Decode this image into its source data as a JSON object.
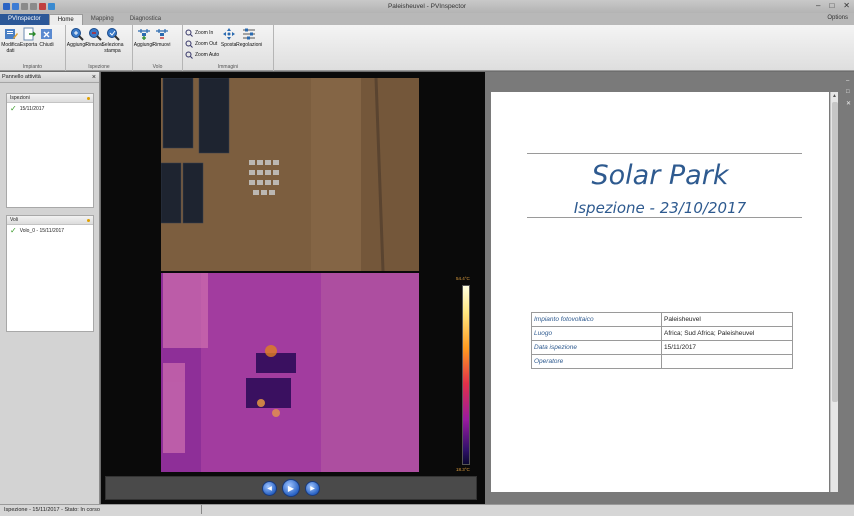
{
  "window": {
    "title": "Paleisheuvel - PVInspector"
  },
  "tabs": {
    "app": "PVInspector",
    "home": "Home",
    "mapping": "Mapping",
    "diagnostica": "Diagnostica",
    "options": "Options"
  },
  "ribbon": {
    "impianto": {
      "label": "Impianto",
      "modifica": "Modifica dati",
      "esporta": "Esporta",
      "chiudi": "Chiudi"
    },
    "ispezione": {
      "label": "Ispezione",
      "aggiungi": "Aggiungi",
      "rimuovi": "Rimuovi",
      "seleziona": "Seleziona stampa"
    },
    "voli": {
      "label": "Volo",
      "aggiungi": "Aggiungi",
      "rimuovi": "Rimuovi"
    },
    "immagini": {
      "label": "Immagini",
      "zoom_in": "Zoom In",
      "zoom_out": "Zoom Out",
      "zoom_auto": "Zoom Auto",
      "sposta": "Sposta",
      "regolazioni": "Regolazioni"
    }
  },
  "left_panel": {
    "title": "Pannello attività",
    "ispezioni": {
      "header": "Ispezioni",
      "item": "15/11/2017"
    },
    "voli": {
      "header": "Voli",
      "item": "Volo_0 - 15/11/2017"
    }
  },
  "viewer": {
    "thermal_max": "54.4°C",
    "thermal_min": "18.3°C"
  },
  "report": {
    "title": "Solar Park",
    "subtitle": "Ispezione - 23/10/2017",
    "rows": [
      {
        "key": "Impianto fotovoltaico",
        "value": "Paleisheuvel"
      },
      {
        "key": "Luogo",
        "value": "Africa; Sud Africa; Paleisheuvel"
      },
      {
        "key": "Data ispezione",
        "value": "15/11/2017"
      },
      {
        "key": "Operatore",
        "value": ""
      }
    ]
  },
  "status": {
    "text": "Ispezione - 15/11/2017 - Stato: In corso"
  }
}
